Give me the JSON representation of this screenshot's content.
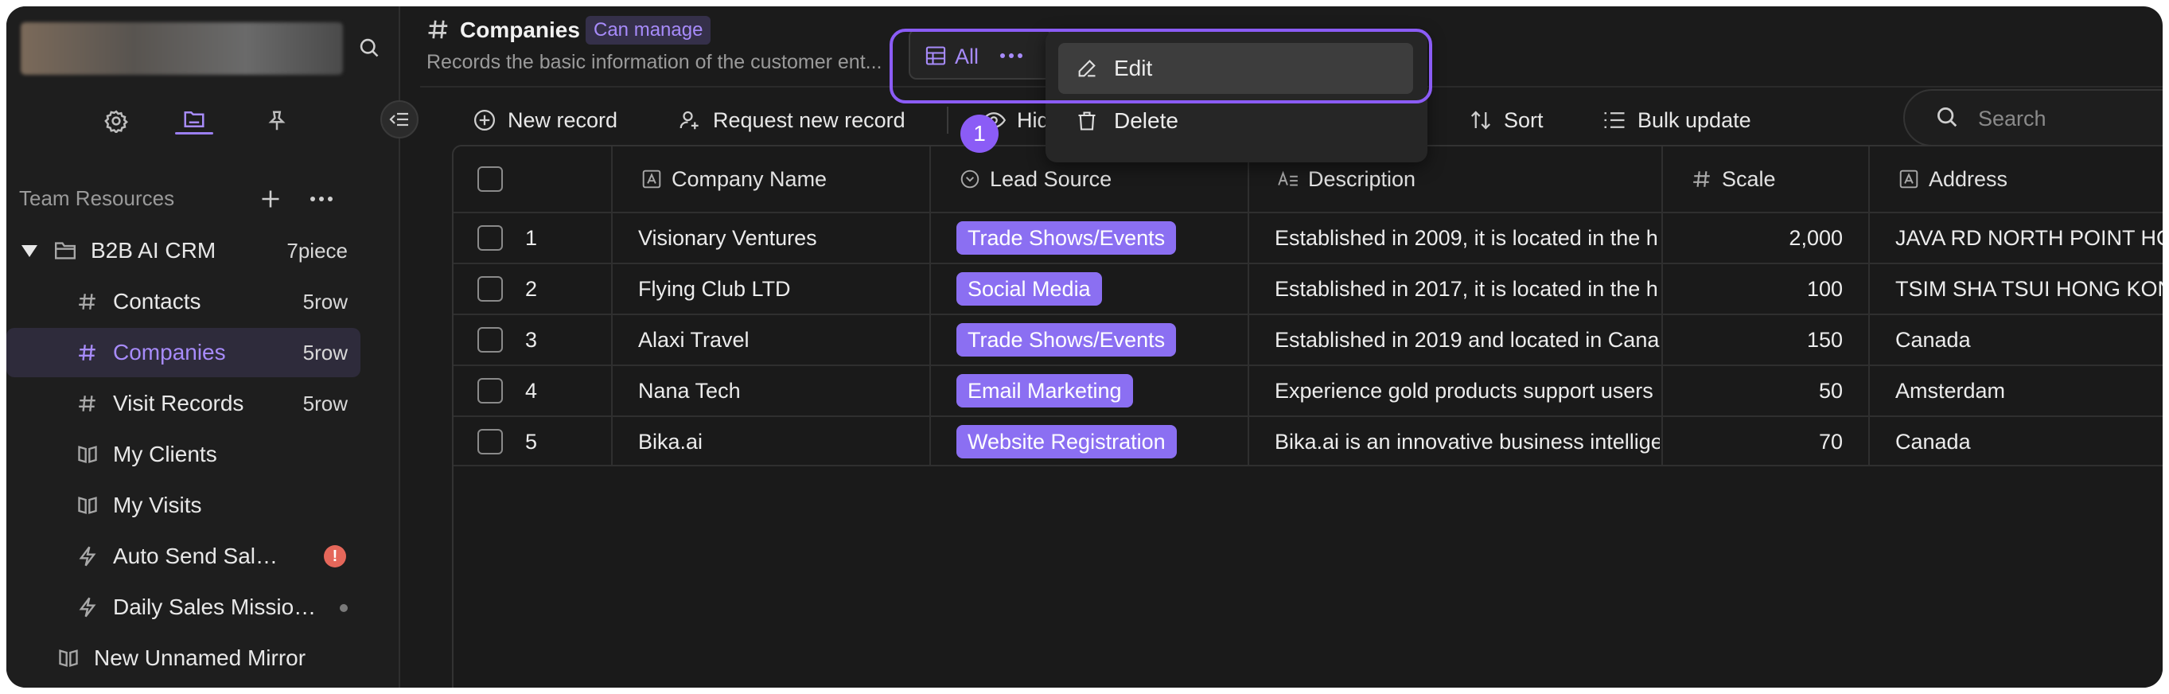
{
  "header": {
    "title": "Companies",
    "permission_badge": "Can manage",
    "subtitle": "Records the basic information of the customer ent..."
  },
  "view_tab": {
    "label": "All"
  },
  "view_menu": {
    "items": [
      {
        "label": "Edit"
      },
      {
        "label": "Delete"
      }
    ]
  },
  "step_marker": "1",
  "toolbar": {
    "new_record": "New record",
    "request_new_record": "Request new record",
    "hide_partial": "Hid",
    "sort": "Sort",
    "bulk_update": "Bulk update",
    "search_placeholder": "Search"
  },
  "sidebar": {
    "section_title": "Team Resources",
    "tree": [
      {
        "label": "B2B AI CRM",
        "count": "7piece"
      },
      {
        "label": "Contacts",
        "count": "5row"
      },
      {
        "label": "Companies",
        "count": "5row"
      },
      {
        "label": "Visit Records",
        "count": "5row"
      },
      {
        "label": "My Clients"
      },
      {
        "label": "My Visits"
      },
      {
        "label": "Auto Send Sales ..."
      },
      {
        "label": "Daily Sales Mission..."
      },
      {
        "label": "New Unnamed Mirror"
      }
    ]
  },
  "table": {
    "columns": [
      "Company Name",
      "Lead Source",
      "Description",
      "Scale",
      "Address"
    ],
    "rows": [
      {
        "index": "1",
        "company": "Visionary Ventures",
        "source": "Trade Shows/Events",
        "description": "Established in 2009, it is located in the h",
        "scale": "2,000",
        "address": "JAVA RD NORTH POINT HO"
      },
      {
        "index": "2",
        "company": "Flying Club LTD",
        "source": "Social Media",
        "description": "Established in 2017, it is located in the h",
        "scale": "100",
        "address": "TSIM SHA TSUI HONG KON"
      },
      {
        "index": "3",
        "company": "Alaxi Travel",
        "source": "Trade Shows/Events",
        "description": "Established in 2019 and located in Cana",
        "scale": "150",
        "address": "Canada"
      },
      {
        "index": "4",
        "company": "Nana Tech",
        "source": "Email Marketing",
        "description": "Experience gold products support users",
        "scale": "50",
        "address": "Amsterdam"
      },
      {
        "index": "5",
        "company": "Bika.ai",
        "source": "Website Registration",
        "description": "Bika.ai is an innovative business intellige",
        "scale": "70",
        "address": "Canada"
      }
    ]
  },
  "colors": {
    "accent": "#8b5cf6",
    "tag": "#8b6ff2",
    "background": "#1b1b1b",
    "alert": "#e5675a"
  }
}
